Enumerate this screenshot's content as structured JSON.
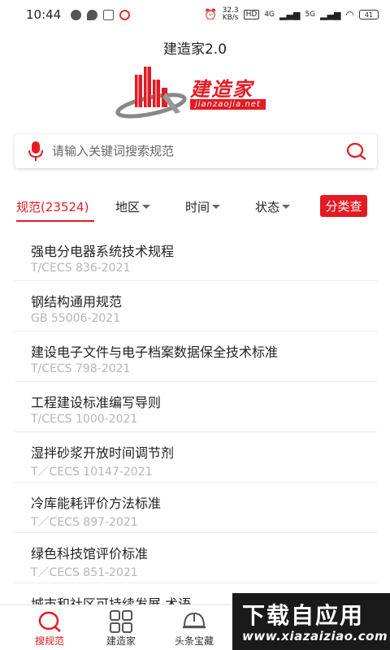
{
  "status": {
    "time": "10:44",
    "network_speed": "32.3\nKB/s",
    "hd_badge": "HD",
    "net1": "4G",
    "net2": "5G",
    "battery": "41"
  },
  "app": {
    "title": "建造家2.0",
    "logo_text": "建造家",
    "logo_url": "jianzaojia.net"
  },
  "search": {
    "placeholder": "请输入关键词搜索规范"
  },
  "filters": {
    "tabs": [
      {
        "label": "规范(23524)"
      },
      {
        "label": "地区"
      },
      {
        "label": "时间"
      },
      {
        "label": "状态"
      }
    ],
    "classify_button": "分类查"
  },
  "items": [
    {
      "title": "强电分电器系统技术规程",
      "code": "T/CECS 836-2021"
    },
    {
      "title": "钢结构通用规范",
      "code": "GB 55006-2021"
    },
    {
      "title": "建设电子文件与电子档案数据保全技术标准",
      "code": "T/CECS 798-2021"
    },
    {
      "title": "工程建设标准编写导则",
      "code": "T/CECS 1000-2021"
    },
    {
      "title": "湿拌砂浆开放时间调节剂",
      "code": "T／CECS 10147-2021"
    },
    {
      "title": "冷库能耗评价方法标准",
      "code": "T／CECS 897-2021"
    },
    {
      "title": "绿色科技馆评价标准",
      "code": "T／CECS 851-2021"
    },
    {
      "title": "城市和社区可持续发展 术语",
      "code": ""
    }
  ],
  "nav": {
    "items": [
      {
        "label": "搜规范"
      },
      {
        "label": "建造家"
      },
      {
        "label": "头条宝藏"
      }
    ]
  },
  "watermark": {
    "cn": "下载自应用",
    "url": "www.xiazaiziao.com"
  },
  "colors": {
    "accent": "#e31b23",
    "muted": "#b5b5b5"
  },
  "icons": [
    "microphone-icon",
    "search-icon",
    "magnifier-nav-icon",
    "grid-icon",
    "helmet-icon"
  ]
}
